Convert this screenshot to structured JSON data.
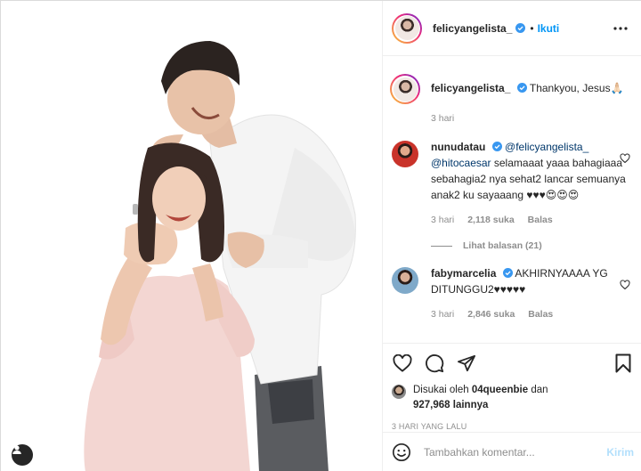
{
  "post": {
    "author": "felicyangelista_",
    "follow_label": "Ikuti",
    "dot": "•"
  },
  "caption": {
    "username": "felicyangelista_",
    "text": "Thankyou, Jesus🙏🏻",
    "time": "3 hari"
  },
  "comments": [
    {
      "username": "nunudatau",
      "mention1": "@felicyangelista_",
      "mention2": "@hitocaesar",
      "text": " selamaaat yaaa bahagiaaa sebahagia2 nya sehat2 lancar semuanya anak2 ku sayaaang ♥♥♥😍😍😍",
      "time": "3 hari",
      "likes": "2,118 suka",
      "reply": "Balas",
      "view_replies": "Lihat balasan (21)"
    },
    {
      "username": "fabymarcelia",
      "text": " AKHIRNYAAAA YG DITUNGGU2♥♥♥♥♥",
      "time": "3 hari",
      "likes": "2,846 suka",
      "reply": "Balas"
    }
  ],
  "likes": {
    "prefix": "Disukai oleh ",
    "liker": "04queenbie",
    "middle": " dan",
    "count": "927,968",
    "suffix": " lainnya"
  },
  "timestamp": "3 HARI YANG LALU",
  "composer": {
    "placeholder": "Tambahkan komentar...",
    "post_label": "Kirim"
  },
  "colors": {
    "accent": "#0095f6",
    "verified": "#3897f0",
    "text": "#262626",
    "muted": "#8e8e8e",
    "border": "#efefef"
  },
  "icons": [
    "heart-icon",
    "comment-icon",
    "share-icon",
    "bookmark-icon",
    "more-icon",
    "emoji-icon",
    "user-tag-icon",
    "verified-icon"
  ]
}
